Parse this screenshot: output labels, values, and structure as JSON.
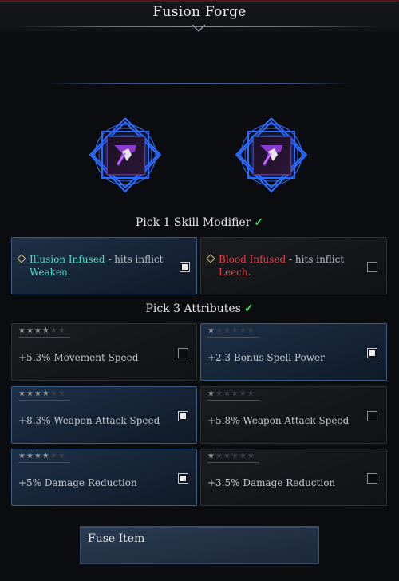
{
  "header": {
    "title": "Fusion Forge"
  },
  "items": [
    {
      "icon": "scythe-icon",
      "accent": "#2c5cff"
    },
    {
      "icon": "scythe-icon",
      "accent": "#2c5cff"
    }
  ],
  "skill_section": {
    "label": "Pick 1 Skill Modifier",
    "check": "✓"
  },
  "modifiers": [
    {
      "name": "Illusion Infused",
      "text": " - hits inflict ",
      "effect": "Weaken",
      "end": ".",
      "selected": true,
      "name_color": "#4fd8c8"
    },
    {
      "name": "Blood Infused",
      "text": " - hits inflict ",
      "effect": "Leech",
      "end": ".",
      "selected": false,
      "name_color": "#e0404a"
    }
  ],
  "attr_section": {
    "label": "Pick 3 Attributes",
    "check": "✓"
  },
  "attributes": [
    {
      "text": "+5.3% Movement Speed",
      "stars": 4,
      "max_stars": 6,
      "selected": false
    },
    {
      "text": "+2.3 Bonus Spell Power",
      "stars": 1,
      "max_stars": 6,
      "selected": true
    },
    {
      "text": "+8.3% Weapon Attack Speed",
      "stars": 4,
      "max_stars": 6,
      "selected": true
    },
    {
      "text": "+5.8% Weapon Attack Speed",
      "stars": 1,
      "max_stars": 6,
      "selected": false
    },
    {
      "text": "+5% Damage Reduction",
      "stars": 4,
      "max_stars": 6,
      "selected": true
    },
    {
      "text": "+3.5% Damage Reduction",
      "stars": 1,
      "max_stars": 6,
      "selected": false
    }
  ],
  "fuse_button": {
    "label": "Fuse Item"
  }
}
